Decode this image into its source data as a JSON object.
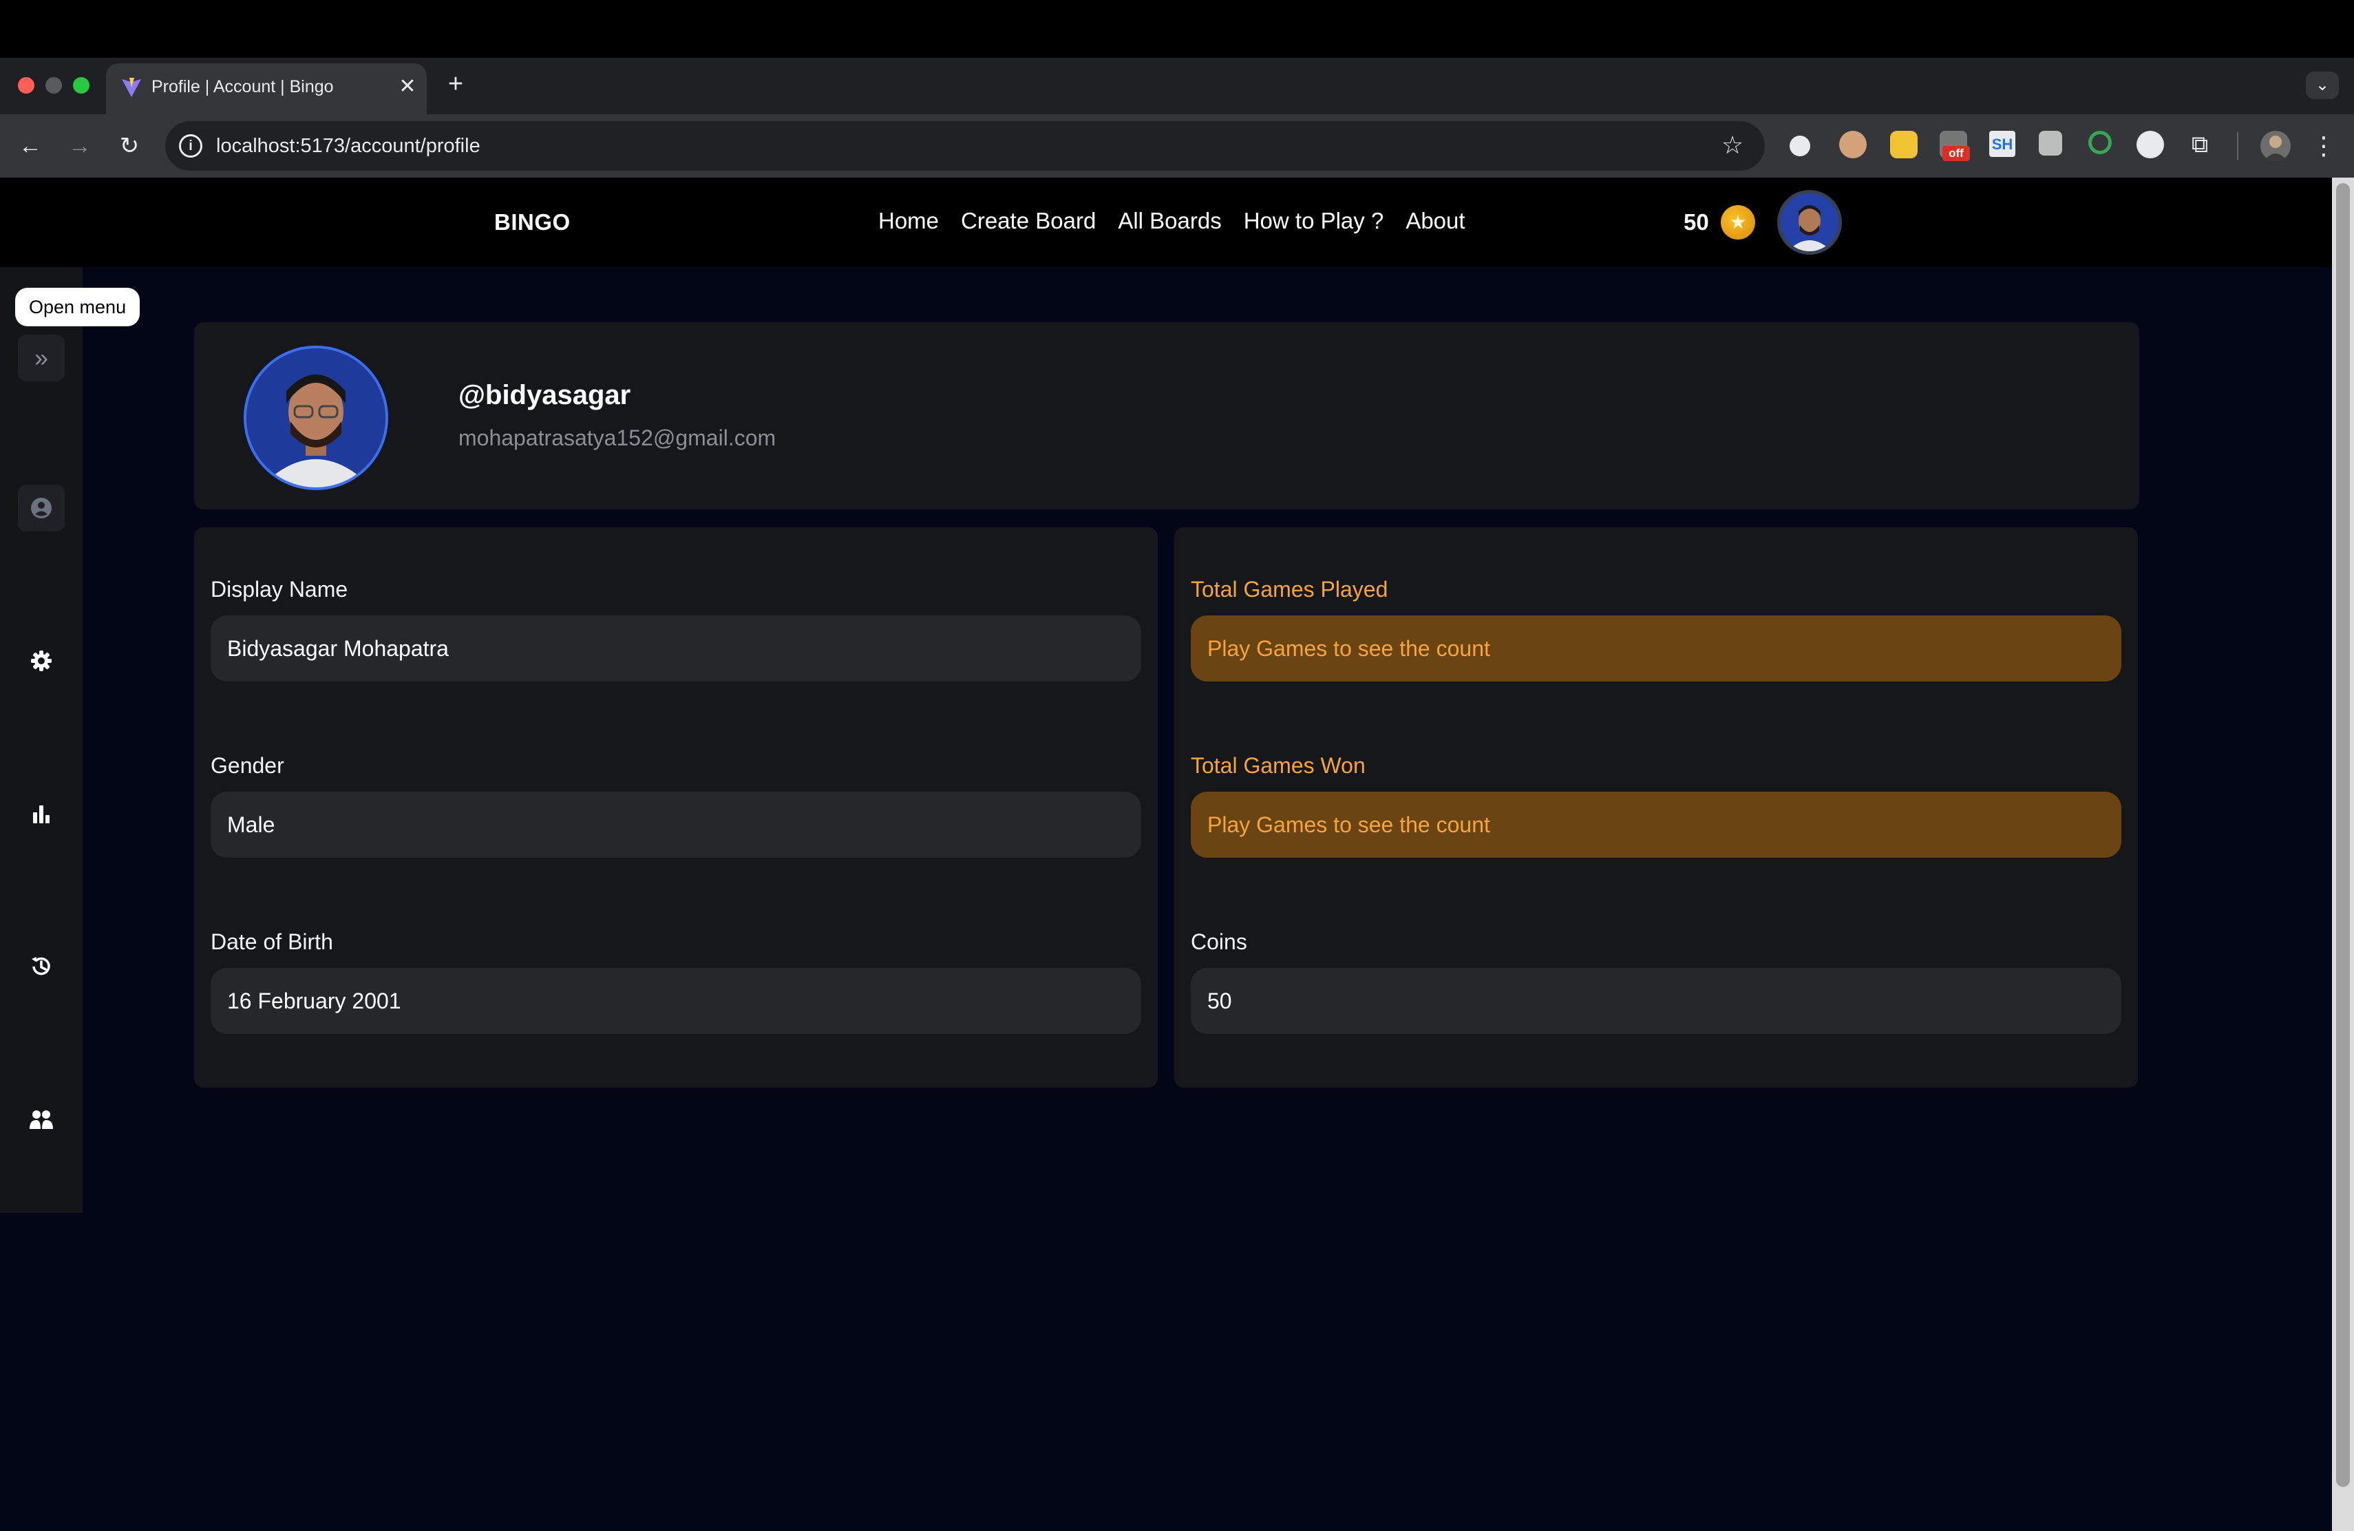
{
  "browser": {
    "tab_title": "Profile | Account | Bingo",
    "tab_close": "✕",
    "new_tab": "+",
    "tab_menu": "⌄",
    "url": "localhost:5173/account/profile",
    "site_info": "i",
    "bookmark": "☆",
    "ext_badge": "off",
    "ext_sh": "SH",
    "puzzle": "⧉",
    "kebab": "⋮",
    "back": "←",
    "forward": "→",
    "reload": "↻"
  },
  "nav": {
    "brand": "BINGO",
    "links": [
      "Home",
      "Create Board",
      "All Boards",
      "How to Play ?",
      "About"
    ],
    "coins": "50",
    "coin_symbol": "★"
  },
  "sidebar": {
    "tooltip": "Open menu",
    "expand": "»",
    "items": [
      "user-circle-icon",
      "gear-icon",
      "bar-chart-icon",
      "history-icon",
      "users-icon"
    ]
  },
  "profile": {
    "username": "@bidyasagar",
    "email": "mohapatrasatya152@gmail.com"
  },
  "personal": {
    "display_name_label": "Display Name",
    "display_name_value": "Bidyasagar Mohapatra",
    "gender_label": "Gender",
    "gender_value": "Male",
    "dob_label": "Date of Birth",
    "dob_value": "16 February 2001"
  },
  "stats": {
    "played_label": "Total Games Played",
    "played_value": "Play Games to see the count",
    "won_label": "Total Games Won",
    "won_value": "Play Games to see the count",
    "coins_label": "Coins",
    "coins_value": "50"
  },
  "colors": {
    "page_bg": "#030616",
    "card_bg": "#16171b",
    "accent_orange": "#f6a53a",
    "orange_field_bg": "#6a4412"
  }
}
